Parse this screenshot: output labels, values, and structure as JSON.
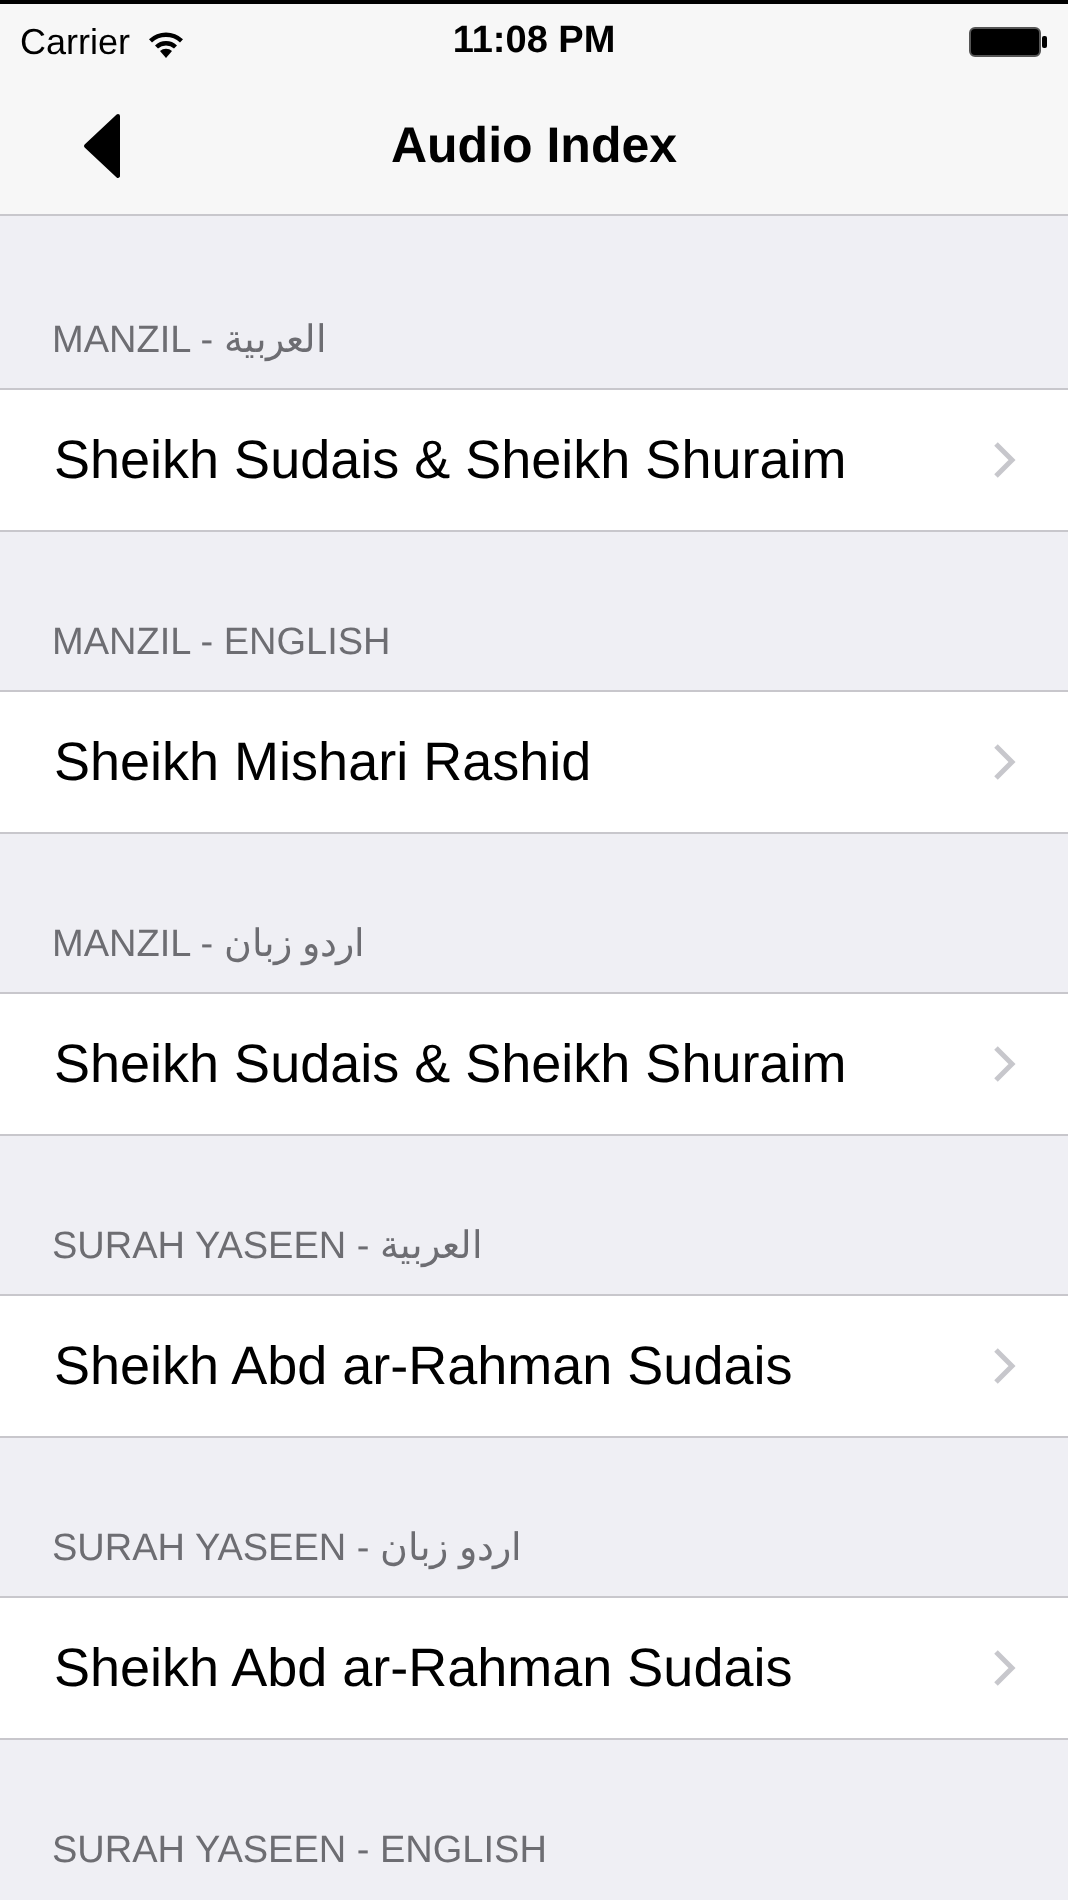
{
  "status_bar": {
    "carrier": "Carrier",
    "time": "11:08 PM"
  },
  "nav_bar": {
    "title": "Audio Index"
  },
  "sections": [
    {
      "header": "MANZIL - العربية",
      "rows": [
        "Sheikh Sudais & Sheikh Shuraim"
      ]
    },
    {
      "header": "MANZIL - ENGLISH",
      "rows": [
        "Sheikh Mishari Rashid"
      ]
    },
    {
      "header": "MANZIL - اردو زبان",
      "rows": [
        "Sheikh Sudais & Sheikh Shuraim"
      ]
    },
    {
      "header": "SURAH YASEEN - العربية",
      "rows": [
        "Sheikh Abd ar-Rahman Sudais"
      ]
    },
    {
      "header": "SURAH YASEEN - اردو زبان",
      "rows": [
        "Sheikh Abd ar-Rahman Sudais"
      ]
    },
    {
      "header": "SURAH YASEEN - ENGLISH"
    }
  ]
}
